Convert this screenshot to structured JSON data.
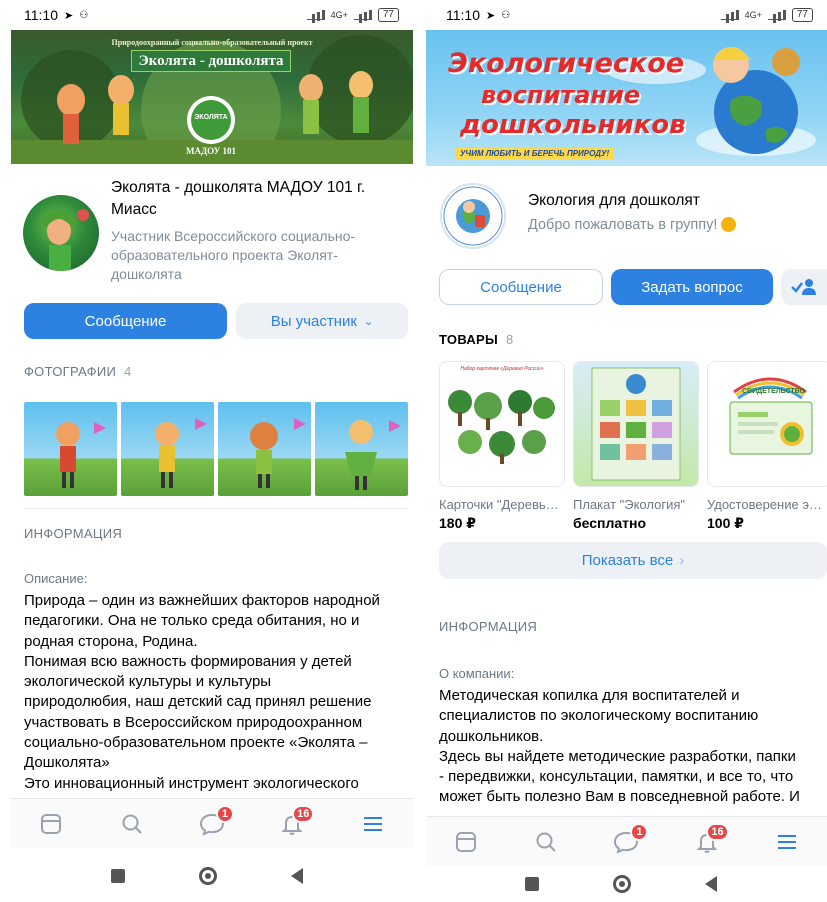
{
  "left": {
    "status": {
      "time": "11:10",
      "battery": "77",
      "network": "4G+"
    },
    "cover": {
      "top_text": "Природоохранный социально-образовательный проект",
      "title": "Эколята - дошколята",
      "badge": "ЭКОЛЯТА",
      "sign": "МАДОУ 101"
    },
    "group": {
      "name": "Эколята - дошколята МАДОУ 101 г. Миасс",
      "status": "Участник Всероссийского социально-образовательного проекта Эколят-дошколята"
    },
    "buttons": {
      "message": "Сообщение",
      "member": "Вы участник"
    },
    "photos": {
      "label": "ФОТОГРАФИИ",
      "count": "4"
    },
    "info": {
      "label": "ИНФОРМАЦИЯ",
      "desc_label": "Описание:",
      "desc_lines": [
        "Природа – один из важнейших факторов народной",
        "педагогики. Она не только среда обитания, но и",
        "родная сторона, Родина.",
        "Понимая всю важность формирования у детей",
        "экологической культуры и культуры",
        "природолюбия, наш детский сад принял решение",
        "участвовать в Всероссийском природоохранном",
        "социально-образовательном проекте «Эколята –",
        "Дошколята»",
        "Это инновационный инструмент экологического"
      ]
    },
    "tabbar": {
      "messages_badge": "1",
      "notifications_badge": "16"
    }
  },
  "right": {
    "status": {
      "time": "11:10",
      "battery": "77",
      "network": "4G+"
    },
    "cover": {
      "line1": "Экологическое",
      "line2": "воспитание",
      "line3": "дошкольников",
      "slogan": "УЧИМ ЛЮБИТЬ И БЕРЕЧЬ ПРИРОДУ!"
    },
    "group": {
      "name": "Экология для дошколят",
      "status": "Добро пожаловать в группу!",
      "avatar_ring_text": "ГРУППА ВКОНТАКТЕ HTTPS://VK.COM/PUBLIC1695"
    },
    "buttons": {
      "message": "Сообщение",
      "ask": "Задать вопрос"
    },
    "goods": {
      "label": "ТОВАРЫ",
      "count": "8",
      "items": [
        {
          "title": "Карточки \"Деревья России\"",
          "price": "180 ₽",
          "img_title": "Набор карточек «Деревья России»"
        },
        {
          "title": "Плакат \"Экология\"",
          "price": "бесплатно",
          "img_title": ""
        },
        {
          "title": "Удостоверение эколят",
          "price": "100 ₽",
          "img_title": "СВИДЕТЕЛЬСТВО"
        }
      ],
      "show_all": "Показать все"
    },
    "info": {
      "label": "ИНФОРМАЦИЯ",
      "desc_label": "О компании:",
      "desc_lines": [
        "Методическая копилка для воспитателей и",
        "специалистов по экологическому воспитанию",
        "дошкольников.",
        "Здесь вы найдете методические разработки, папки",
        "- передвижки, консультации, памятки, и все то, что",
        "может быть полезно Вам в повседневной работе. И"
      ]
    },
    "tabbar": {
      "messages_badge": "1",
      "notifications_badge": "16"
    }
  },
  "colors": {
    "accent": "#2d81e0",
    "badge": "#e64646",
    "secondary_bg": "#edf0f5",
    "muted": "#818c99"
  }
}
